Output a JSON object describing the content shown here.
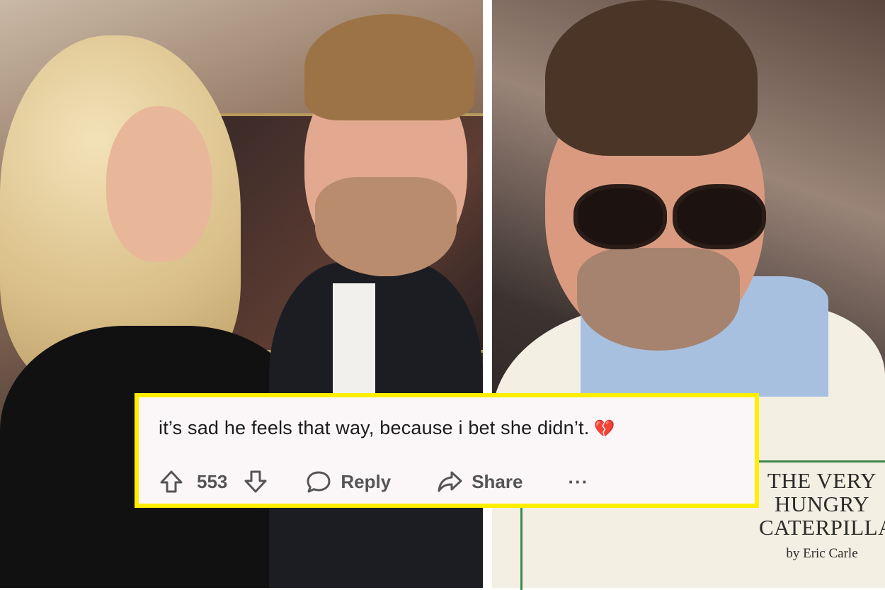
{
  "comment": {
    "text": "it’s sad he feels that way, because i bet she didn’t.",
    "emoji": "💔",
    "vote_count": "553",
    "reply_label": "Reply",
    "share_label": "Share",
    "more_label": "···"
  },
  "sweater_print": {
    "line1": "THE VERY",
    "line2": "HUNGRY",
    "line3": "CATERPILLAR",
    "byline": "by Eric Carle"
  },
  "colors": {
    "highlight_border": "#ffee00",
    "card_background": "#fbf7f8",
    "action_gray": "#555555",
    "heart_red": "#e8322f"
  },
  "icons": {
    "upvote": "arrow-up-icon",
    "downvote": "arrow-down-icon",
    "reply": "speech-bubble-icon",
    "share": "share-arrow-icon",
    "more": "ellipsis-icon"
  }
}
